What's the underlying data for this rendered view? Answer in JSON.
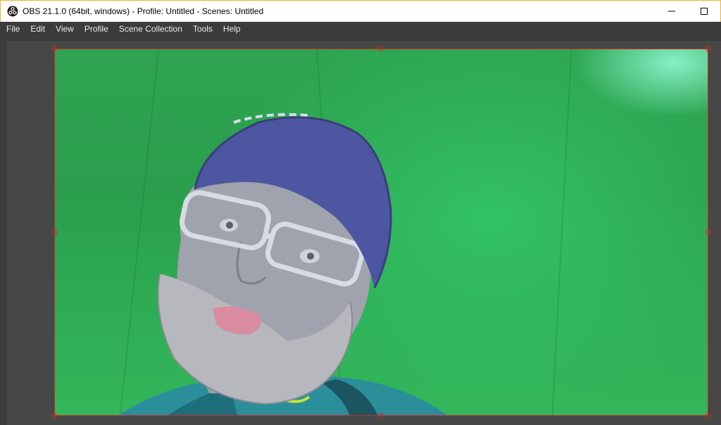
{
  "window": {
    "title": "OBS 21.1.0 (64bit, windows) - Profile: Untitled - Scenes: Untitled",
    "app_icon": "obs-logo-icon",
    "controls": [
      "minimize-icon",
      "maximize-icon"
    ]
  },
  "menu": {
    "items": [
      "File",
      "Edit",
      "View",
      "Profile",
      "Scene Collection",
      "Tools",
      "Help"
    ]
  },
  "preview": {
    "source": "webcam-video-capture",
    "selection_color": "#d02828",
    "background_color": "#2ea350"
  }
}
